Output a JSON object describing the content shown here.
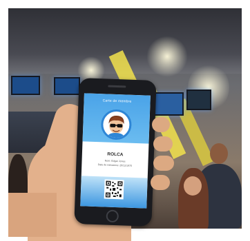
{
  "card": {
    "title": "Carte de membre",
    "name": "ROLCA",
    "nom_line": "Nom: Edgar Jones",
    "birth_line": "Date de naissance: 26/11/1970"
  },
  "colors": {
    "card_blue": "#4aa3e8",
    "avatar_ring": "#2e86d6",
    "hand_skin": "#e3b18c",
    "phone_body": "#1a1b1f"
  },
  "icons": {
    "avatar": "cartoon-man-with-sunglasses",
    "code": "qr-code"
  }
}
